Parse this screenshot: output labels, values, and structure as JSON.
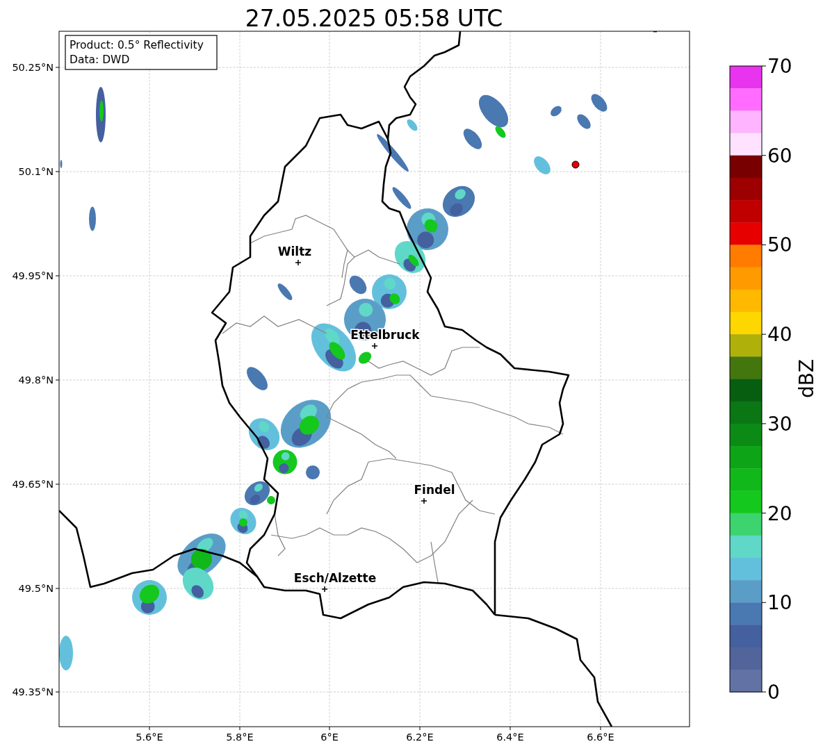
{
  "title": "27.05.2025 05:58 UTC",
  "info_box": [
    "Product: 0.5° Reflectivity",
    "Data: DWD"
  ],
  "cities": [
    {
      "name": "Wiltz"
    },
    {
      "name": "Ettelbruck"
    },
    {
      "name": "Findel"
    },
    {
      "name": "Esch/Alzette"
    }
  ],
  "x_ticks": [
    "5.6°E",
    "5.8°E",
    "6°E",
    "6.2°E",
    "6.4°E",
    "6.6°E"
  ],
  "y_ticks": [
    "50.25°N",
    "50.1°N",
    "49.95°N",
    "49.8°N",
    "49.65°N",
    "49.5°N",
    "49.35°N"
  ],
  "colorbar": {
    "label": "dBZ",
    "ticks": [
      "70",
      "60",
      "50",
      "40",
      "30",
      "20",
      "10",
      "0"
    ],
    "bins": [
      {
        "color": "#e834ee"
      },
      {
        "color": "#ff6cff"
      },
      {
        "color": "#ffb4ff"
      },
      {
        "color": "#ffe2ff"
      },
      {
        "color": "#780000"
      },
      {
        "color": "#9c0000"
      },
      {
        "color": "#c00000"
      },
      {
        "color": "#e60000"
      },
      {
        "color": "#ff7c00"
      },
      {
        "color": "#ff9a00"
      },
      {
        "color": "#ffb900"
      },
      {
        "color": "#ffd700"
      },
      {
        "color": "#b0b00a"
      },
      {
        "color": "#44760e"
      },
      {
        "color": "#085e10"
      },
      {
        "color": "#0a7614"
      },
      {
        "color": "#0c8a16"
      },
      {
        "color": "#0ea417"
      },
      {
        "color": "#10b81a"
      },
      {
        "color": "#14c81e"
      },
      {
        "color": "#3dd470"
      },
      {
        "color": "#60d8c8"
      },
      {
        "color": "#63c0dc"
      },
      {
        "color": "#5a9ec8"
      },
      {
        "color": "#4a78b0"
      },
      {
        "color": "#44609f"
      },
      {
        "color": "#52659b"
      },
      {
        "color": "#6272a4"
      }
    ]
  }
}
